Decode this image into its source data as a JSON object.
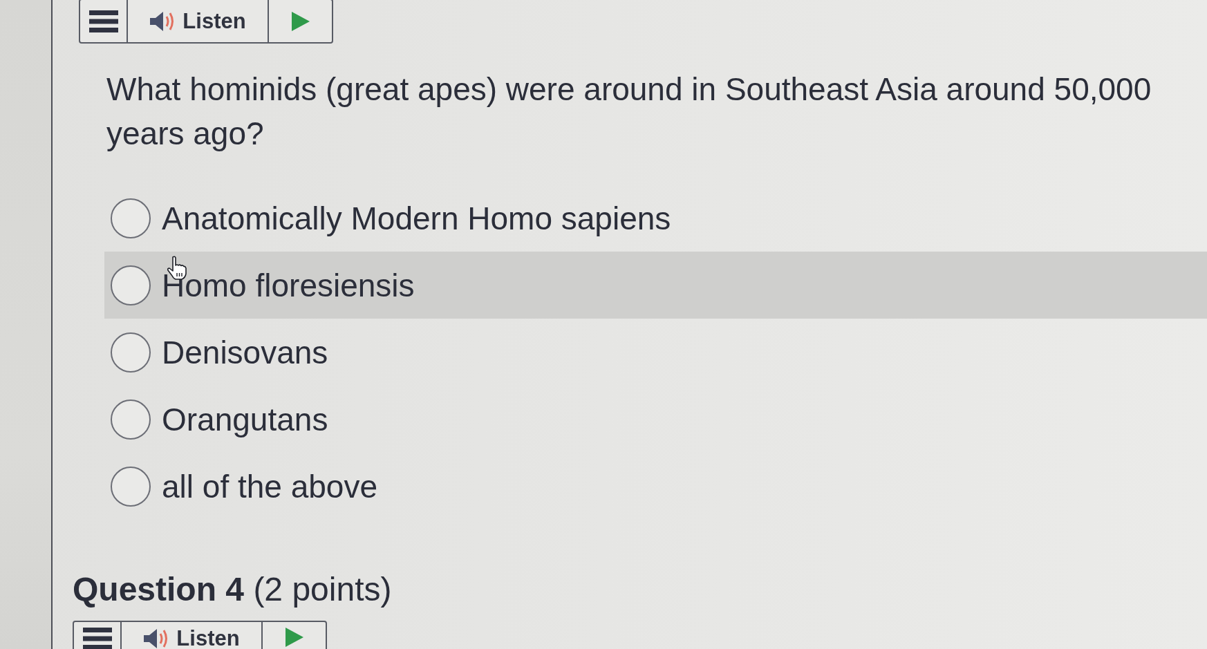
{
  "question": {
    "toolbar": {
      "listen_label": "Listen"
    },
    "prompt": "What hominids (great apes) were around in Southeast Asia around 50,000 years ago?",
    "options": [
      {
        "label": "Anatomically Modern Homo sapiens",
        "selected": false,
        "hovered": false
      },
      {
        "label": "Homo floresiensis",
        "selected": false,
        "hovered": true
      },
      {
        "label": "Denisovans",
        "selected": false,
        "hovered": false
      },
      {
        "label": "Orangutans",
        "selected": false,
        "hovered": false
      },
      {
        "label": "all of the above",
        "selected": false,
        "hovered": false
      }
    ]
  },
  "next_question": {
    "heading": "**Question 4** (2 points)",
    "toolbar": {
      "listen_label": "Listen"
    }
  }
}
